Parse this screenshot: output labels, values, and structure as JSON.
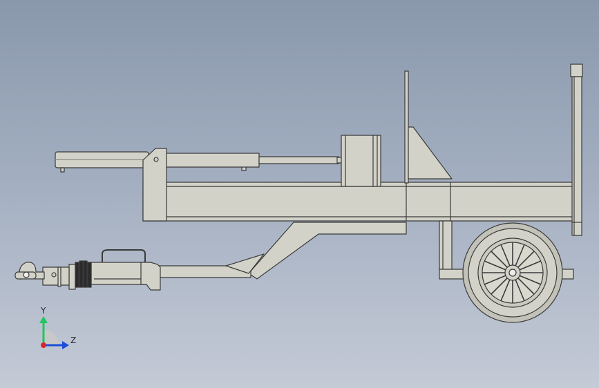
{
  "viewport": {
    "background_top": "#8a98ac",
    "background_bottom": "#c4cad6"
  },
  "model": {
    "name_icon": "log-splitter-trailer-model",
    "part_fill": "#d2d2c8",
    "part_stroke": "#3a3a3a"
  },
  "triad": {
    "y_label": "Y",
    "z_label": "Z",
    "y_color": "#22c55e",
    "z_color": "#1d4ed8",
    "x_color": "#dc2626"
  }
}
